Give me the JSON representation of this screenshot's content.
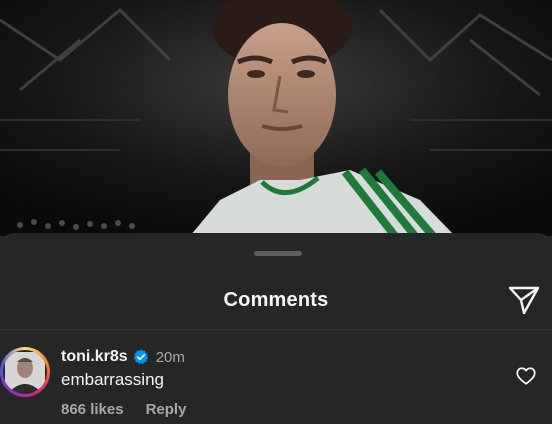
{
  "sheet": {
    "title": "Comments"
  },
  "comment": {
    "username": "toni.kr8s",
    "verified": true,
    "time": "20m",
    "text": "embarrassing",
    "likes": "866 likes",
    "reply_label": "Reply"
  },
  "icons": {
    "share": "paper-plane-icon",
    "verified": "verified-badge-icon",
    "like": "heart-outline-icon"
  },
  "colors": {
    "sheet_bg": "#262626",
    "verified_blue": "#0095f6",
    "text_primary": "#f5f5f5",
    "text_secondary": "#a8a8a8"
  }
}
